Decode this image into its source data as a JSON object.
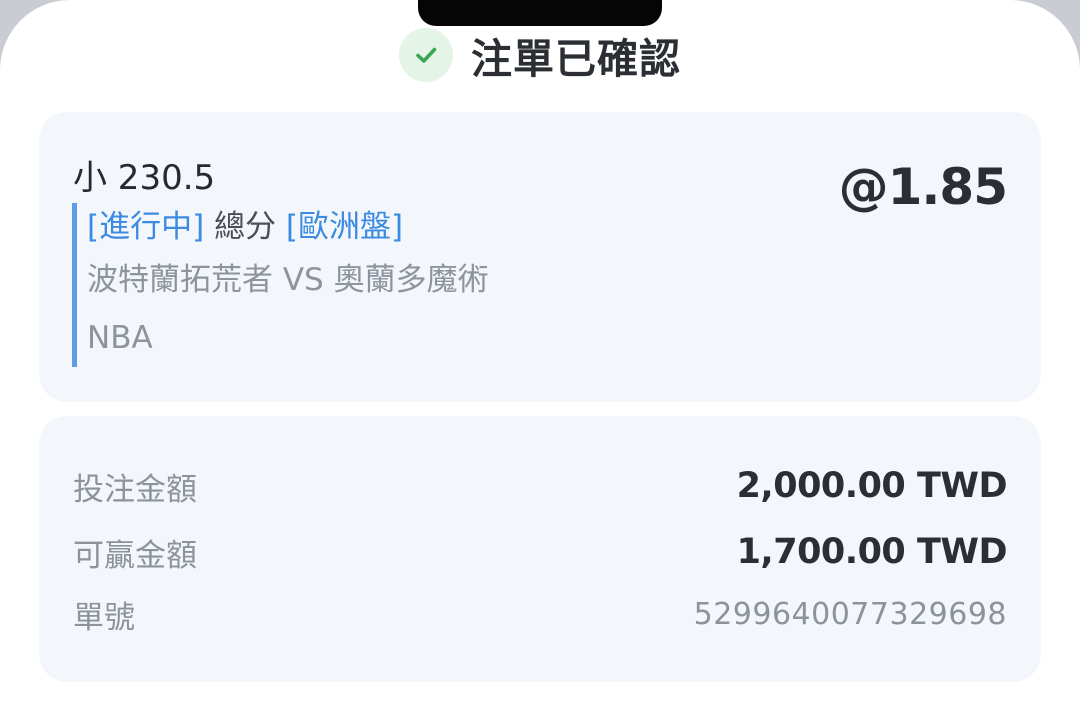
{
  "header": {
    "title": "注單已確認",
    "check_icon": "check-circle-icon",
    "check_color": "#3aa655"
  },
  "bet": {
    "selection": "小 230.5",
    "odds": "@1.85",
    "status_tag": "[進行中]",
    "market": "總分",
    "odds_format_tag": "[歐洲盤]",
    "match": "波特蘭拓荒者 VS 奧蘭多魔術",
    "league": "NBA"
  },
  "summary": {
    "stake_label": "投注金額",
    "stake_value": "2,000.00 TWD",
    "payout_label": "可贏金額",
    "payout_value": "1,700.00 TWD",
    "ticket_label": "單號",
    "ticket_value": "5299640077329698"
  },
  "colors": {
    "accent": "#3d8be0",
    "card_bg": "#f3f7fc",
    "success": "#3aa655"
  }
}
